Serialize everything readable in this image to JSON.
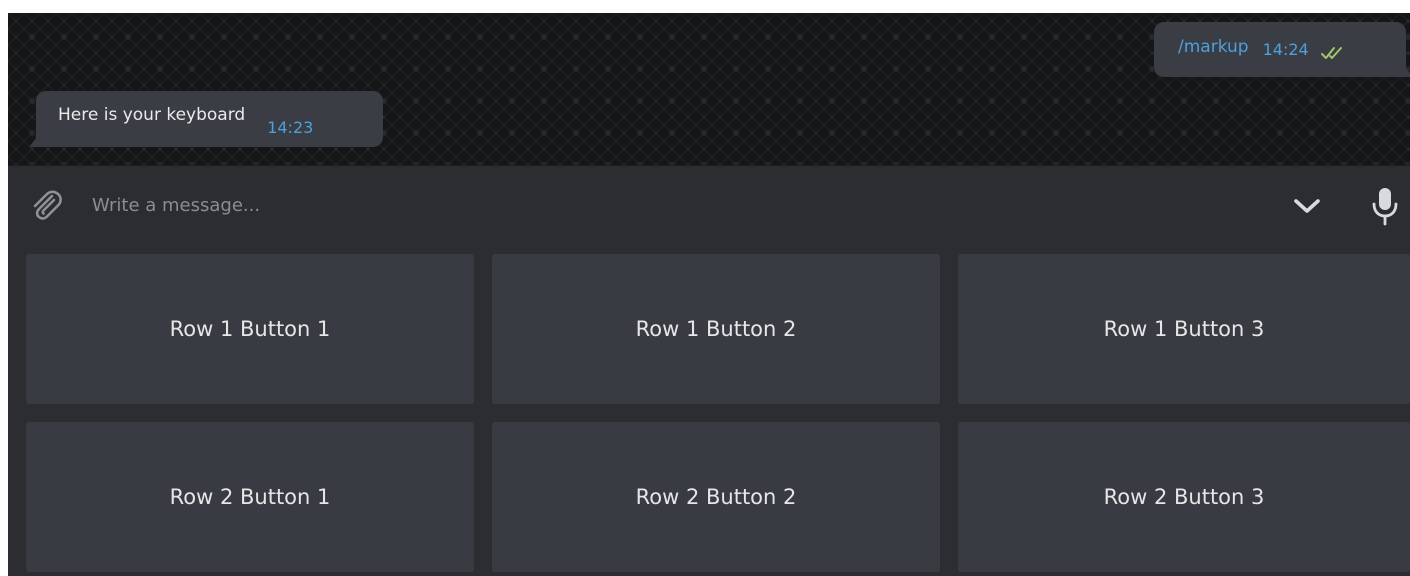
{
  "messages": [
    {
      "direction": "out",
      "text": "/markup",
      "time": "14:24",
      "status": "read"
    },
    {
      "direction": "in",
      "text": "Here is your keyboard",
      "time": "14:23"
    }
  ],
  "composer": {
    "placeholder": "Write a message...",
    "attach_icon": "paperclip-icon",
    "collapse_icon": "chevron-down-icon",
    "mic_icon": "microphone-icon"
  },
  "keyboard": {
    "rows": [
      [
        "Row 1 Button 1",
        "Row 1 Button 2",
        "Row 1 Button 3"
      ],
      [
        "Row 2 Button 1",
        "Row 2 Button 2",
        "Row 2 Button 3"
      ]
    ]
  },
  "colors": {
    "accent": "#4e9fde",
    "read_check": "#a3c46b",
    "bubble": "#3a3e44",
    "panel": "#2b2d31",
    "key": "#383b42"
  }
}
